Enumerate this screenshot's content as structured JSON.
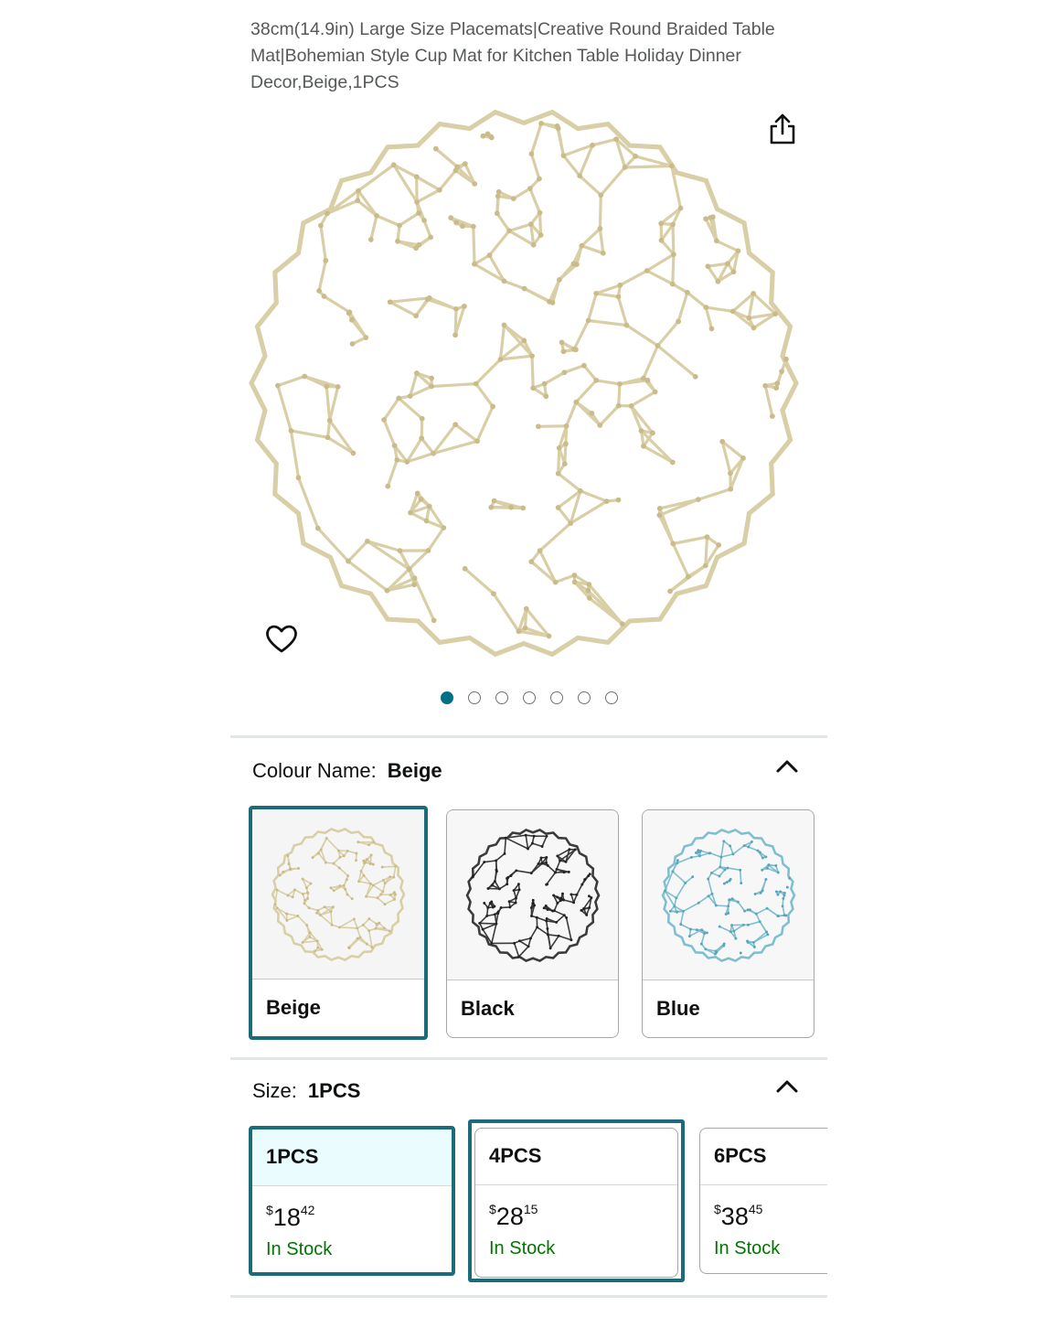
{
  "product": {
    "title": "38cm(14.9in) Large Size Placemats|Creative Round Braided Table Mat|Bohemian Style Cup Mat for Kitchen Table Holiday Dinner Decor,Beige,1PCS",
    "image_count": 7,
    "active_image_index": 0
  },
  "icons": {
    "share": "share-icon",
    "wishlist": "heart-icon",
    "collapse": "chevron-up-icon"
  },
  "colour": {
    "label": "Colour Name:",
    "selected": "Beige",
    "options": [
      {
        "name": "Beige",
        "color": "#d9cfa6"
      },
      {
        "name": "Black",
        "color": "#3b3b3b"
      },
      {
        "name": "Blue",
        "color": "#7fbfcf"
      }
    ]
  },
  "size": {
    "label": "Size:",
    "selected": "1PCS",
    "options": [
      {
        "name": "1PCS",
        "price_dollars": "18",
        "price_cents": "42",
        "currency": "$",
        "stock": "In Stock"
      },
      {
        "name": "4PCS",
        "price_dollars": "28",
        "price_cents": "15",
        "currency": "$",
        "stock": "In Stock"
      },
      {
        "name": "6PCS",
        "price_dollars": "38",
        "price_cents": "45",
        "currency": "$",
        "stock": "In Stock"
      }
    ]
  },
  "colors": {
    "accent": "#007185",
    "selected_border": "#1b6b7a",
    "in_stock": "#007600",
    "selected_header_bg": "#eafcfd"
  }
}
